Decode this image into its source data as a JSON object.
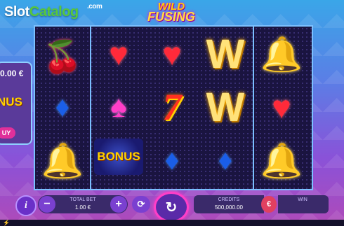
{
  "watermark": {
    "part_a": "Slot",
    "part_b": "Catalog",
    "suffix": ".com"
  },
  "logo": {
    "line1": "WILD",
    "line2": "FUSING"
  },
  "side_panel": {
    "amount": "0.00 €",
    "bonus_text": "NUS",
    "buy_label": "UY"
  },
  "reels": {
    "columns": [
      {
        "symbols": [
          "cherry-icon",
          "diamond-icon",
          "bell-icon"
        ]
      },
      {
        "symbols": [
          "heart-icon",
          "spade-icon",
          "bonus-icon"
        ]
      },
      {
        "symbols": [
          "heart-icon",
          "seven-icon",
          "diamond-icon"
        ]
      },
      {
        "symbols": [
          "wild-icon",
          "wild-icon",
          "diamond-icon"
        ]
      },
      {
        "symbols": [
          "bell-icon",
          "heart-icon",
          "bell-icon"
        ]
      }
    ],
    "bonus_text": "BONUS",
    "seven_text": "7",
    "wild_text": "W"
  },
  "controls": {
    "info_label": "i",
    "minus_label": "−",
    "plus_label": "+",
    "total_bet_label": "TOTAL BET",
    "total_bet_value": "1.00 €",
    "credits_label": "CREDITS",
    "credits_value": "500,000.00",
    "currency_label": "€",
    "win_label": "WIN"
  },
  "colors": {
    "accent": "#ff3ec8",
    "panel": "#3a2a6a",
    "reel_border": "#7bc0ff"
  }
}
